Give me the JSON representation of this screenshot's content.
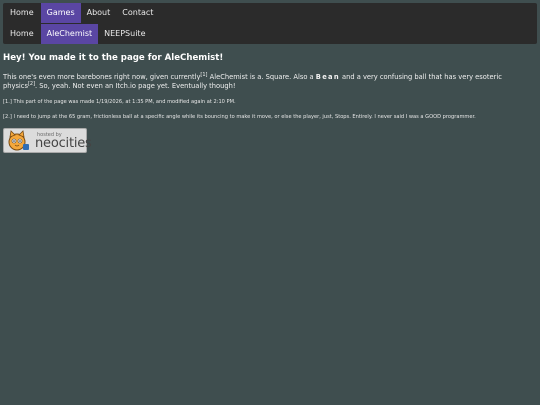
{
  "nav": {
    "row1": [
      {
        "label": "Home",
        "active": false
      },
      {
        "label": "Games",
        "active": true
      },
      {
        "label": "About",
        "active": false
      },
      {
        "label": "Contact",
        "active": false
      }
    ],
    "row2": [
      {
        "label": "Home",
        "active": false
      },
      {
        "label": "AleChemist",
        "active": true
      },
      {
        "label": "NEEPSuite",
        "active": false
      }
    ]
  },
  "main": {
    "heading": "Hey! You made it to the page for AleChemist!",
    "para": {
      "part1": "This one's even more barebones right now, given currently",
      "ref1": "[1]",
      "part2": " AleChemist is a. Square. Also a ",
      "bean": "Bean",
      "part3": " and a very confusing ball that has very esoteric physics",
      "ref2": "[2]",
      "part4": ". So, yeah. Not even an Itch.io page yet. Eventually though!"
    },
    "footnote1": "[1.] This part of the page was made 1/19/2026, at 1:35 PM, and modified again at 2:10 PM.",
    "footnote2": "[2.] I need to jump at the 65 gram, frictionless ball at a specific angle while its bouncing to make it move, or else the player, just, Stops. Entirely. I never said I was a GOOD programmer."
  },
  "badge": {
    "hosted": "hosted by",
    "name": "neocities"
  }
}
